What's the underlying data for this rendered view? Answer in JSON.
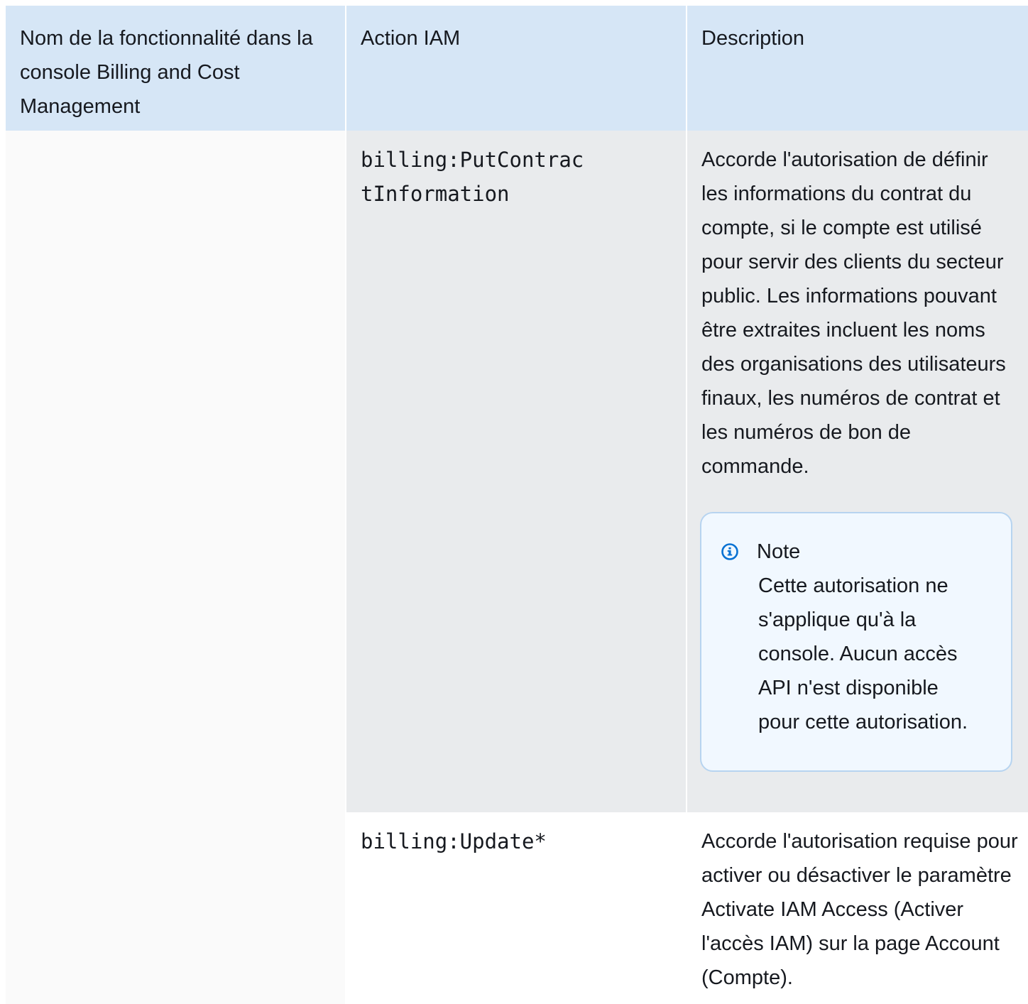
{
  "headers": {
    "feature": "Nom de la fonctionnalité dans la console Billing and Cost Management",
    "action": "Action IAM",
    "description": "Description"
  },
  "rows": [
    {
      "feature": "",
      "action_line1": "billing:PutContrac",
      "action_line2": "tInformation",
      "description": "Accorde l'autorisation de définir les informations du contrat du compte, si le compte est utilisé pour servir des clients du secteur public. Les informations pouvant être extraites incluent les noms des organisations des utilisateurs finaux, les numéros de contrat et les numéros de bon de commande.",
      "note": {
        "title": "Note",
        "body": "Cette autorisation ne s'applique qu'à la console. Aucun accès API n'est disponible pour cette autorisation.",
        "icon": "info-icon",
        "color": "#0972d3"
      }
    },
    {
      "feature": "",
      "action_line1": "billing:Update*",
      "description": "Accorde l'autorisation requise pour activer ou désactiver le paramètre Activate IAM Access (Activer l'accès IAM) sur la page Account (Compte)."
    }
  ]
}
